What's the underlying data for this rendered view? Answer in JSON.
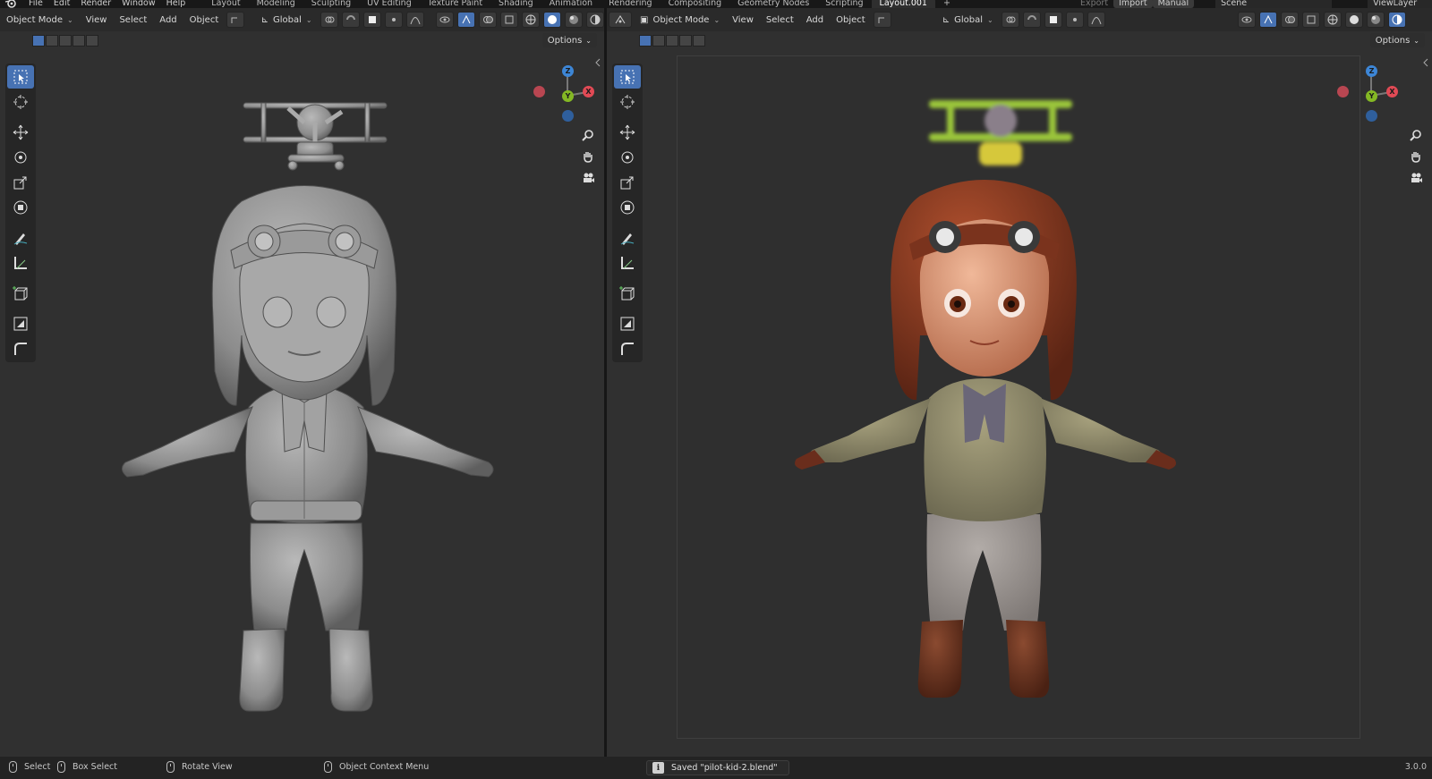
{
  "topbar": {
    "menu": [
      "File",
      "Edit",
      "Render",
      "Window",
      "Help"
    ],
    "workspaces": [
      "Layout",
      "Modeling",
      "Sculpting",
      "UV Editing",
      "Texture Paint",
      "Shading",
      "Animation",
      "Rendering",
      "Compositing",
      "Geometry Nodes",
      "Scripting",
      "Layout.001"
    ],
    "active_workspace": "Layout.001",
    "add_tab": "+",
    "export_label": "Export",
    "import_label": "Import",
    "manual_label": "Manual",
    "scene_label": "Scene",
    "view_layer_label": "ViewLayer"
  },
  "left_editor": {
    "mode": "Object Mode",
    "menus": [
      "View",
      "Select",
      "Add",
      "Object"
    ],
    "transform_orientation": "Global",
    "options_label": "Options",
    "viewport_shading": "solid",
    "gizmo": {
      "z": "Z",
      "y": "Y",
      "x": "X"
    }
  },
  "right_editor": {
    "mode": "Object Mode",
    "menus": [
      "View",
      "Select",
      "Add",
      "Object"
    ],
    "transform_orientation": "Global",
    "options_label": "Options",
    "viewport_shading": "rendered",
    "gizmo": {
      "z": "Z",
      "y": "Y",
      "x": "X"
    }
  },
  "tools": [
    "select-box",
    "cursor",
    "move",
    "rotate",
    "scale",
    "transform",
    "annotate",
    "measure",
    "add-cube",
    "extrude",
    "bevel"
  ],
  "statusbar": {
    "select": "Select",
    "box_select": "Box Select",
    "rotate_view": "Rotate View",
    "context_menu": "Object Context Menu",
    "saved_message": "Saved \"pilot-kid-2.blend\"",
    "version": "3.0.0"
  },
  "colors": {
    "accent": "#4772b3",
    "axis_x": "#e14a55",
    "axis_y": "#84b824",
    "axis_z": "#3d86d6",
    "viewport_bg": "#303030",
    "header_bg": "#2a2a2a"
  }
}
